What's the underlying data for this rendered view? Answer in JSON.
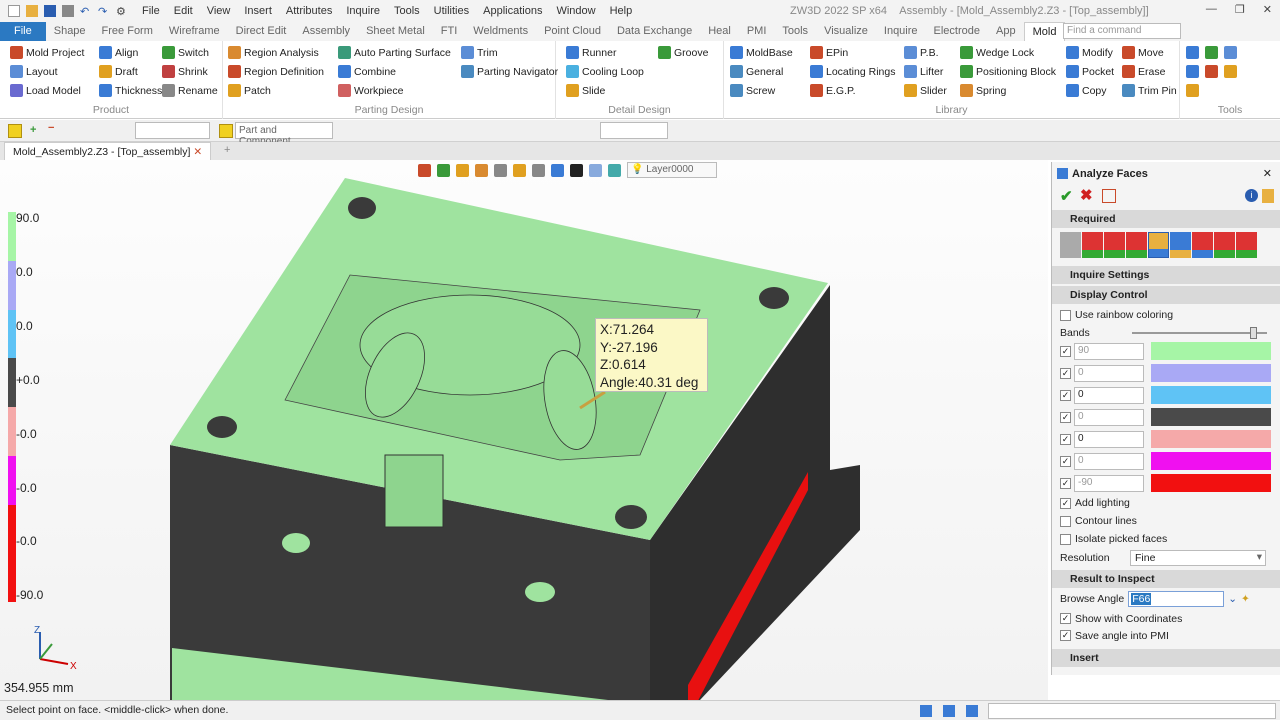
{
  "menus": [
    "File",
    "Edit",
    "View",
    "Insert",
    "Attributes",
    "Inquire",
    "Tools",
    "Utilities",
    "Applications",
    "Window",
    "Help"
  ],
  "window_title": "ZW3D 2022 SP x64",
  "doc_title": "Assembly - [Mold_Assembly2.Z3 - [Top_assembly]]",
  "ribbon_tabs": [
    "File",
    "Shape",
    "Free Form",
    "Wireframe",
    "Direct Edit",
    "Assembly",
    "Sheet Metal",
    "FTI",
    "Weldments",
    "Point Cloud",
    "Data Exchange",
    "Heal",
    "PMI",
    "Tools",
    "Visualize",
    "Inquire",
    "Electrode",
    "App",
    "Mold"
  ],
  "active_tab": "Mold",
  "find_command": "Find a command",
  "groups": {
    "product": {
      "label": "Product",
      "cmds": [
        "Mold Project",
        "Align",
        "Switch",
        "Layout",
        "Draft",
        "Shrink",
        "Load Model",
        "Thickness",
        "Rename"
      ]
    },
    "parting": {
      "label": "Parting Design",
      "cmds": [
        "Region Analysis",
        "Auto Parting Surface",
        "Trim",
        "Region Definition",
        "Combine",
        "Parting Navigator",
        "Patch",
        "Workpiece"
      ]
    },
    "detail": {
      "label": "Detail Design",
      "cmds": [
        "Runner",
        "Groove",
        "Cooling Loop",
        "Slide"
      ]
    },
    "library": {
      "label": "Library",
      "cmds": [
        "MoldBase",
        "EPin",
        "P.B.",
        "Wedge Lock",
        "Modify",
        "Move",
        "General",
        "Locating Rings",
        "Lifter",
        "Positioning Block",
        "Pocket",
        "Erase",
        "Screw",
        "E.G.P.",
        "Slider",
        "Spring",
        "Copy",
        "Trim Pin"
      ]
    },
    "tools": {
      "label": "Tools"
    }
  },
  "toolbar_filter": "Part and Component",
  "doc_tab": "Mold_Assembly2.Z3 - [Top_assembly]",
  "layer": "Layer0000",
  "scale_labels": [
    "90.0",
    "0.0",
    "0.0",
    "+0.0",
    "-0.0",
    "-0.0",
    "-0.0",
    "-90.0"
  ],
  "tooltip": {
    "x": "X:71.264",
    "y": "Y:-27.196",
    "z": "Z:0.614",
    "angle": "Angle:40.31 deg"
  },
  "view_size": "354.955 mm",
  "panel": {
    "title": "Analyze Faces",
    "required": "Required",
    "inquire_settings": "Inquire Settings",
    "display_control": "Display Control",
    "rainbow": "Use rainbow coloring",
    "bands_label": "Bands",
    "bands": [
      {
        "value": "90",
        "color": "#a6f5a6",
        "on": false
      },
      {
        "value": "0",
        "color": "#a9a9f5",
        "on": false
      },
      {
        "value": "0",
        "color": "#5fc3f5",
        "on": true
      },
      {
        "value": "0",
        "color": "#4a4a4a",
        "on": false
      },
      {
        "value": "0",
        "color": "#f5a9a9",
        "on": true
      },
      {
        "value": "0",
        "color": "#f010f0",
        "on": false
      },
      {
        "value": "-90",
        "color": "#f21010",
        "on": false
      }
    ],
    "add_lighting": "Add lighting",
    "contour": "Contour lines",
    "isolate": "Isolate picked faces",
    "resolution_label": "Resolution",
    "resolution": "Fine",
    "result": "Result to Inspect",
    "browse_label": "Browse Angle",
    "browse_value": "F66",
    "show_coords": "Show with Coordinates",
    "save_pmi": "Save angle into PMI",
    "insert": "Insert"
  },
  "status": "Select point on face.  <middle-click> when done."
}
